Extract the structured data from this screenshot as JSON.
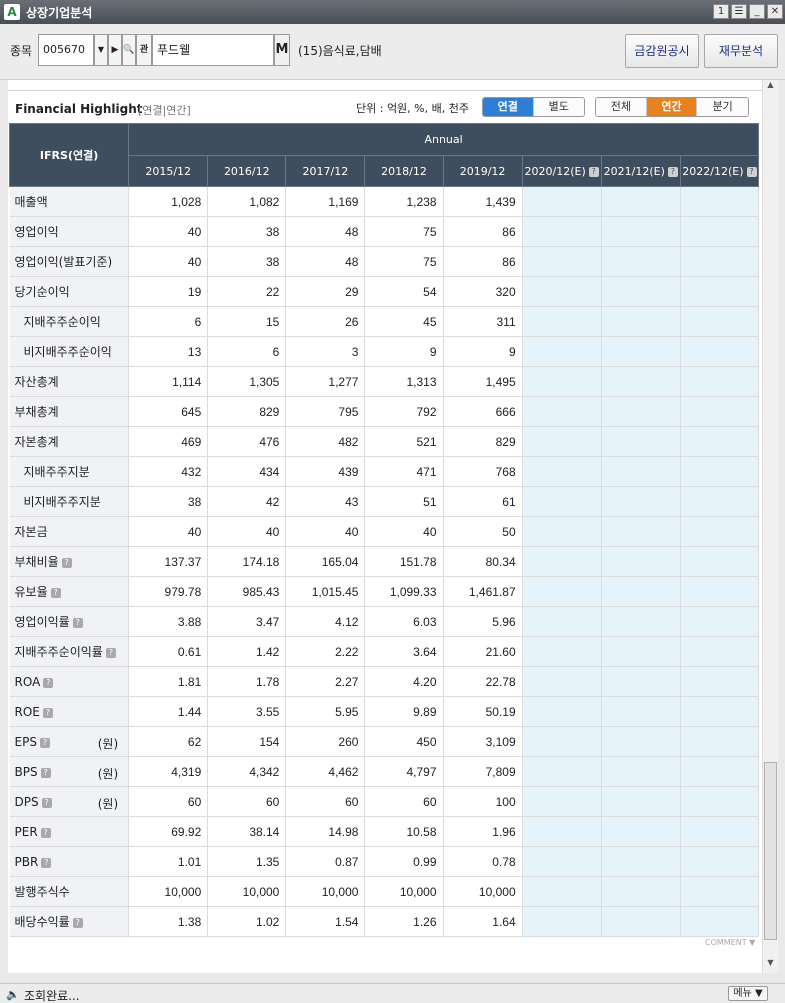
{
  "window": {
    "title": "상장기업분석",
    "app_icon": "A",
    "btn_number": "1"
  },
  "search": {
    "code_label": "종목",
    "code_value": "005670",
    "stock_name": "푸드웰",
    "m_label": "M",
    "industry": "(15)음식료,담배",
    "disclosure_btn": "금감원공시",
    "finance_btn": "재무분석"
  },
  "highlight": {
    "title": "Financial Highlight",
    "subtitle": "[연결|연간]",
    "unit": "단위 : 억원, %, 배, 천주",
    "scope_tabs": [
      "연결",
      "별도"
    ],
    "period_tabs": [
      "전체",
      "연간",
      "분기"
    ],
    "colors": {
      "consolidated_active": "#2c7fd6",
      "period_active": "#e8821c",
      "header_bg": "#3f4e5e",
      "estimate_bg": "#e6f3fa"
    }
  },
  "table": {
    "corner": "IFRS(연결)",
    "group_label": "Annual",
    "columns": [
      "2015/12",
      "2016/12",
      "2017/12",
      "2018/12",
      "2019/12",
      "2020/12(E)",
      "2021/12(E)",
      "2022/12(E)"
    ],
    "rows": [
      {
        "label": "매출액",
        "values": [
          "1,028",
          "1,082",
          "1,169",
          "1,238",
          "1,439"
        ]
      },
      {
        "label": "영업이익",
        "values": [
          "40",
          "38",
          "48",
          "75",
          "86"
        ]
      },
      {
        "label": "영업이익(발표기준)",
        "values": [
          "40",
          "38",
          "48",
          "75",
          "86"
        ]
      },
      {
        "label": "당기순이익",
        "values": [
          "19",
          "22",
          "29",
          "54",
          "320"
        ]
      },
      {
        "label": "지배주주순이익",
        "indent": true,
        "values": [
          "6",
          "15",
          "26",
          "45",
          "311"
        ]
      },
      {
        "label": "비지배주주순이익",
        "indent": true,
        "values": [
          "13",
          "6",
          "3",
          "9",
          "9"
        ]
      },
      {
        "label": "자산총계",
        "values": [
          "1,114",
          "1,305",
          "1,277",
          "1,313",
          "1,495"
        ]
      },
      {
        "label": "부채총계",
        "values": [
          "645",
          "829",
          "795",
          "792",
          "666"
        ]
      },
      {
        "label": "자본총계",
        "values": [
          "469",
          "476",
          "482",
          "521",
          "829"
        ]
      },
      {
        "label": "지배주주지분",
        "indent": true,
        "values": [
          "432",
          "434",
          "439",
          "471",
          "768"
        ]
      },
      {
        "label": "비지배주주지분",
        "indent": true,
        "values": [
          "38",
          "42",
          "43",
          "51",
          "61"
        ]
      },
      {
        "label": "자본금",
        "values": [
          "40",
          "40",
          "40",
          "40",
          "50"
        ]
      },
      {
        "label": "부채비율",
        "help": true,
        "values": [
          "137.37",
          "174.18",
          "165.04",
          "151.78",
          "80.34"
        ]
      },
      {
        "label": "유보율",
        "help": true,
        "values": [
          "979.78",
          "985.43",
          "1,015.45",
          "1,099.33",
          "1,461.87"
        ]
      },
      {
        "label": "영업이익률",
        "help": true,
        "values": [
          "3.88",
          "3.47",
          "4.12",
          "6.03",
          "5.96"
        ]
      },
      {
        "label": "지배주주순이익률",
        "help": true,
        "values": [
          "0.61",
          "1.42",
          "2.22",
          "3.64",
          "21.60"
        ]
      },
      {
        "label": "ROA",
        "help": true,
        "values": [
          "1.81",
          "1.78",
          "2.27",
          "4.20",
          "22.78"
        ]
      },
      {
        "label": "ROE",
        "help": true,
        "values": [
          "1.44",
          "3.55",
          "5.95",
          "9.89",
          "50.19"
        ]
      },
      {
        "label": "EPS",
        "help": true,
        "unit": "(원)",
        "values": [
          "62",
          "154",
          "260",
          "450",
          "3,109"
        ]
      },
      {
        "label": "BPS",
        "help": true,
        "unit": "(원)",
        "values": [
          "4,319",
          "4,342",
          "4,462",
          "4,797",
          "7,809"
        ]
      },
      {
        "label": "DPS",
        "help": true,
        "unit": "(원)",
        "values": [
          "60",
          "60",
          "60",
          "60",
          "100"
        ]
      },
      {
        "label": "PER",
        "help": true,
        "values": [
          "69.92",
          "38.14",
          "14.98",
          "10.58",
          "1.96"
        ]
      },
      {
        "label": "PBR",
        "help": true,
        "values": [
          "1.01",
          "1.35",
          "0.87",
          "0.99",
          "0.78"
        ]
      },
      {
        "label": "발행주식수",
        "values": [
          "10,000",
          "10,000",
          "10,000",
          "10,000",
          "10,000"
        ]
      },
      {
        "label": "배당수익률",
        "help": true,
        "values": [
          "1.38",
          "1.02",
          "1.54",
          "1.26",
          "1.64"
        ]
      }
    ]
  },
  "footer": {
    "comment": "COMMENT",
    "status": "조회완료...",
    "menu_btn": "메뉴"
  }
}
